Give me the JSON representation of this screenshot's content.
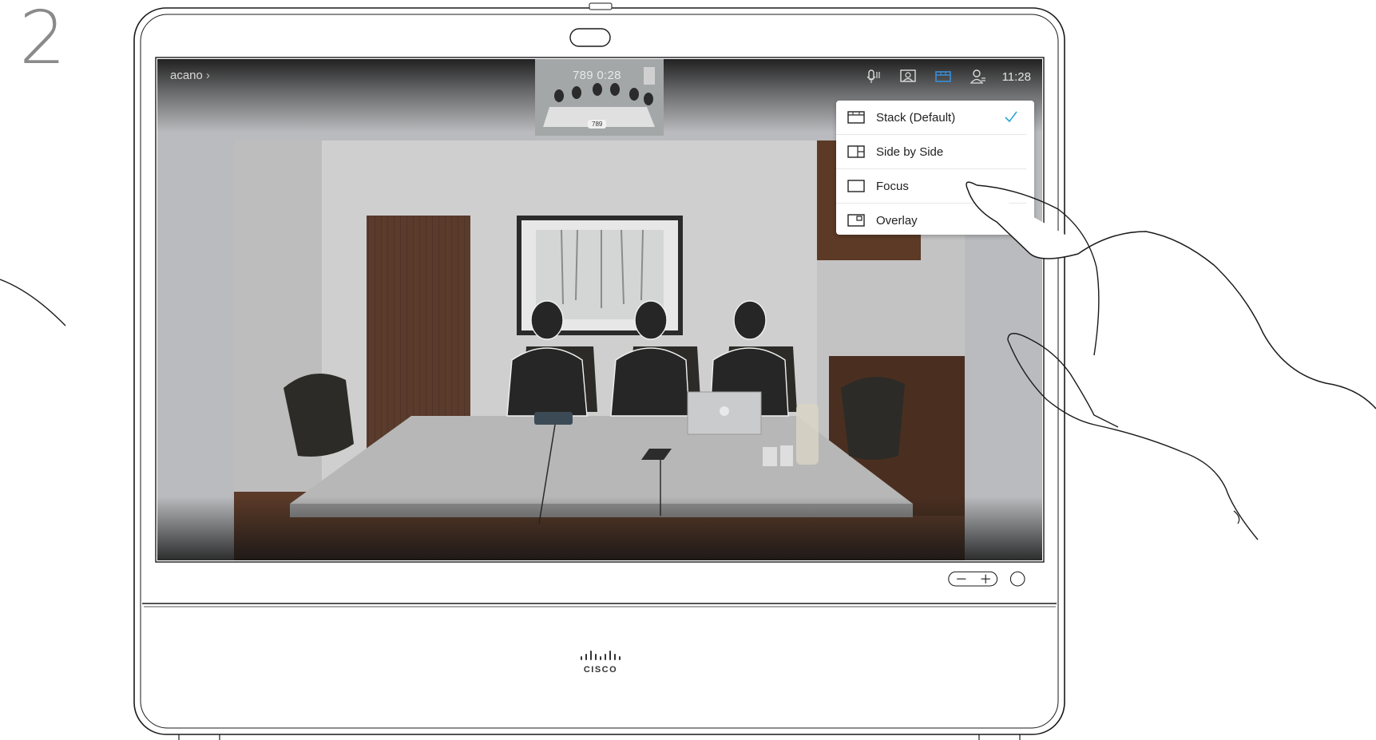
{
  "step": "2",
  "call": {
    "room_name": "acano",
    "chevron": "›",
    "info": "789  0:28",
    "self_view_tag": "789"
  },
  "status_bar": {
    "icons": [
      "microphone-icon",
      "presentation-icon",
      "layout-icon",
      "participants-icon"
    ],
    "clock": "11:28"
  },
  "layout_menu": {
    "items": [
      {
        "label": "Stack (Default)",
        "icon": "stack-layout-icon",
        "selected": true
      },
      {
        "label": "Side by Side",
        "icon": "side-by-side-layout-icon",
        "selected": false
      },
      {
        "label": "Focus",
        "icon": "focus-layout-icon",
        "selected": false
      },
      {
        "label": "Overlay",
        "icon": "overlay-layout-icon",
        "selected": false
      }
    ]
  },
  "volume": {
    "minus": "−",
    "plus": "+"
  },
  "brand": {
    "logo_text": "CISCO"
  },
  "colors": {
    "accent": "#2aa7d8",
    "layout_icon_active": "#3a8fd9",
    "menu_bg": "#ffffff"
  }
}
